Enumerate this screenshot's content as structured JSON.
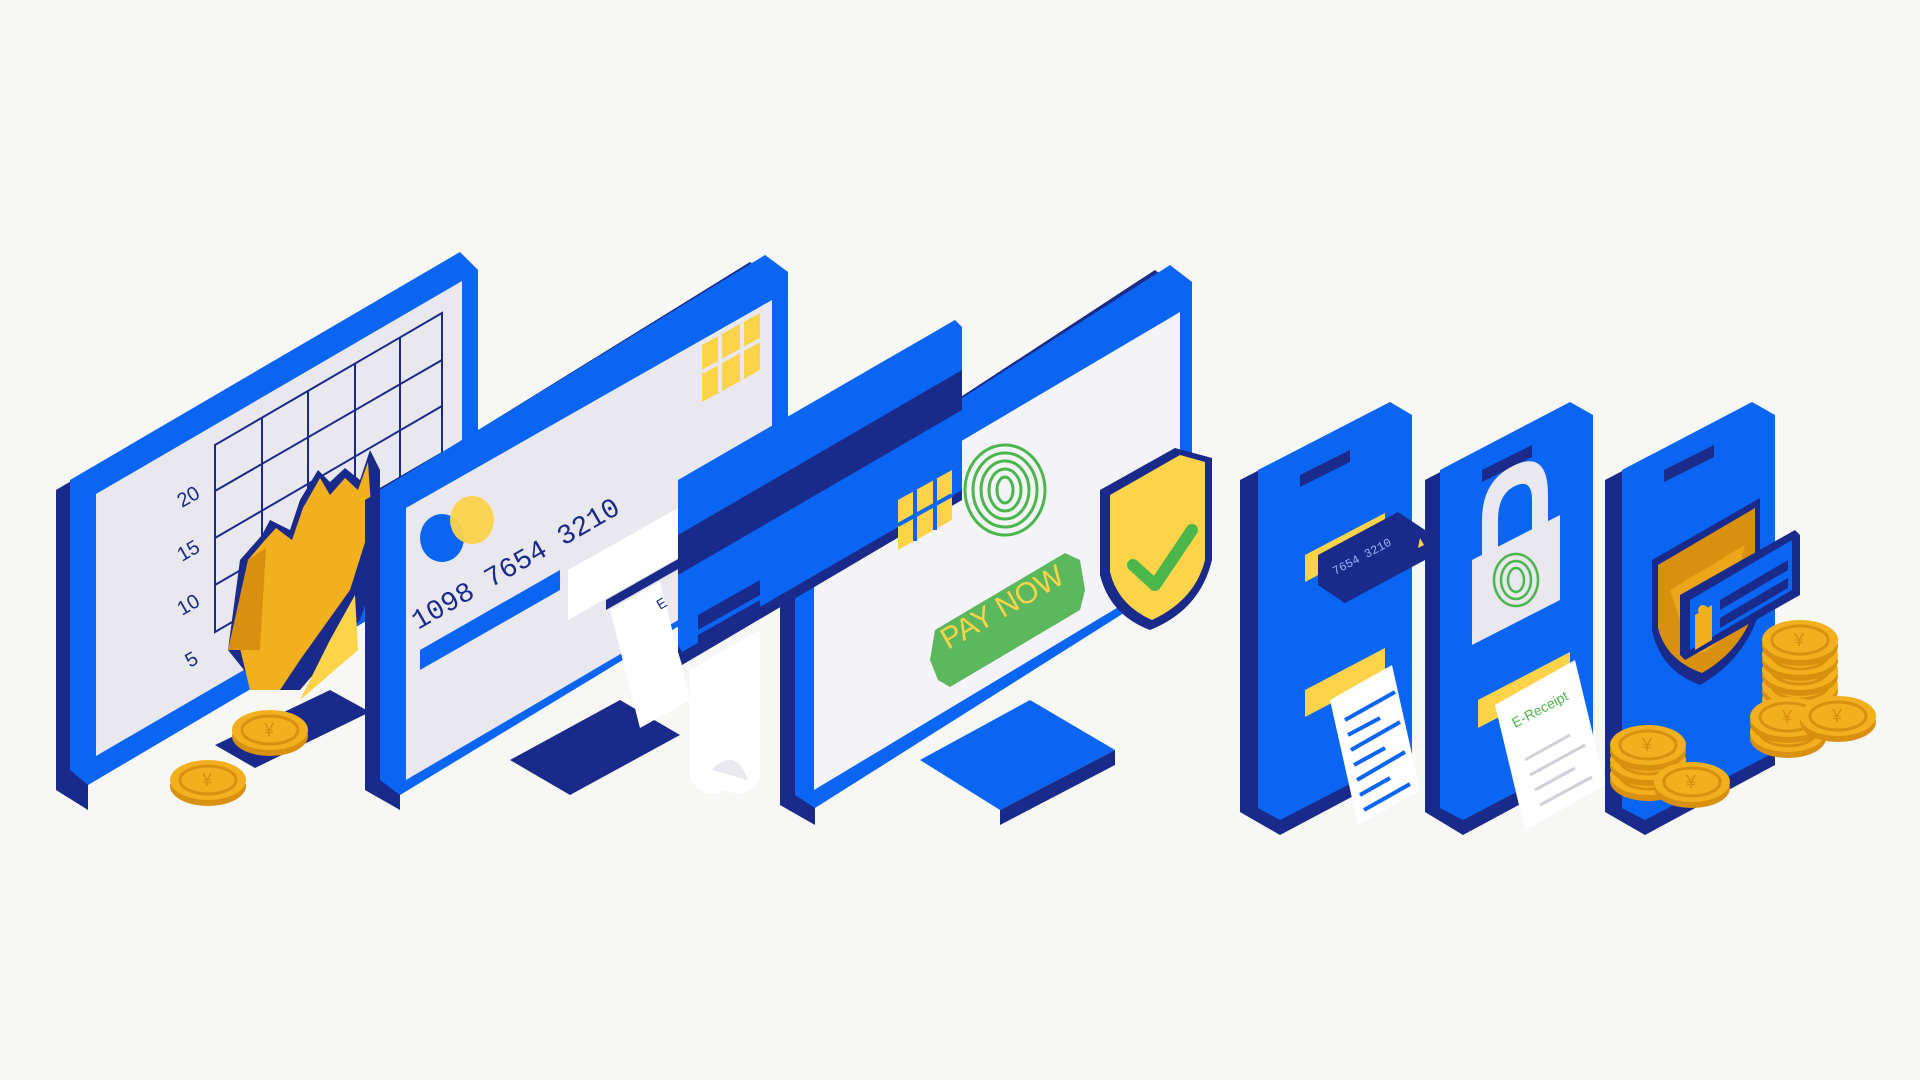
{
  "colors": {
    "background": "#f7f7f5",
    "blue": "#0a66f2",
    "navy": "#1a2a8a",
    "screen": "#e8e8ee",
    "white": "#ffffff",
    "gold": "#f2b01e",
    "gold_dark": "#d9900f",
    "yellow": "#fdd34a",
    "green": "#5cb85c",
    "light_green": "#4bb64b"
  },
  "monitor_chart": {
    "y_tick_labels": [
      "20",
      "15",
      "10",
      "5"
    ]
  },
  "credit_card_monitor": {
    "card_number": "1098  7654  3210",
    "receipt_text": "E"
  },
  "payment_monitor": {
    "pay_button_label": "PAY NOW"
  },
  "phone_card": {
    "card_number": "7654 3210"
  },
  "phone_lock": {
    "receipt_label": "E-Receipt"
  },
  "coins": {
    "symbol": "¥"
  },
  "icons": [
    "bar-chart-icon",
    "credit-card-icon",
    "chip-icon",
    "fingerprint-icon",
    "shield-check-icon",
    "padlock-icon",
    "user-shield-icon",
    "coin-icon",
    "receipt-icon"
  ]
}
